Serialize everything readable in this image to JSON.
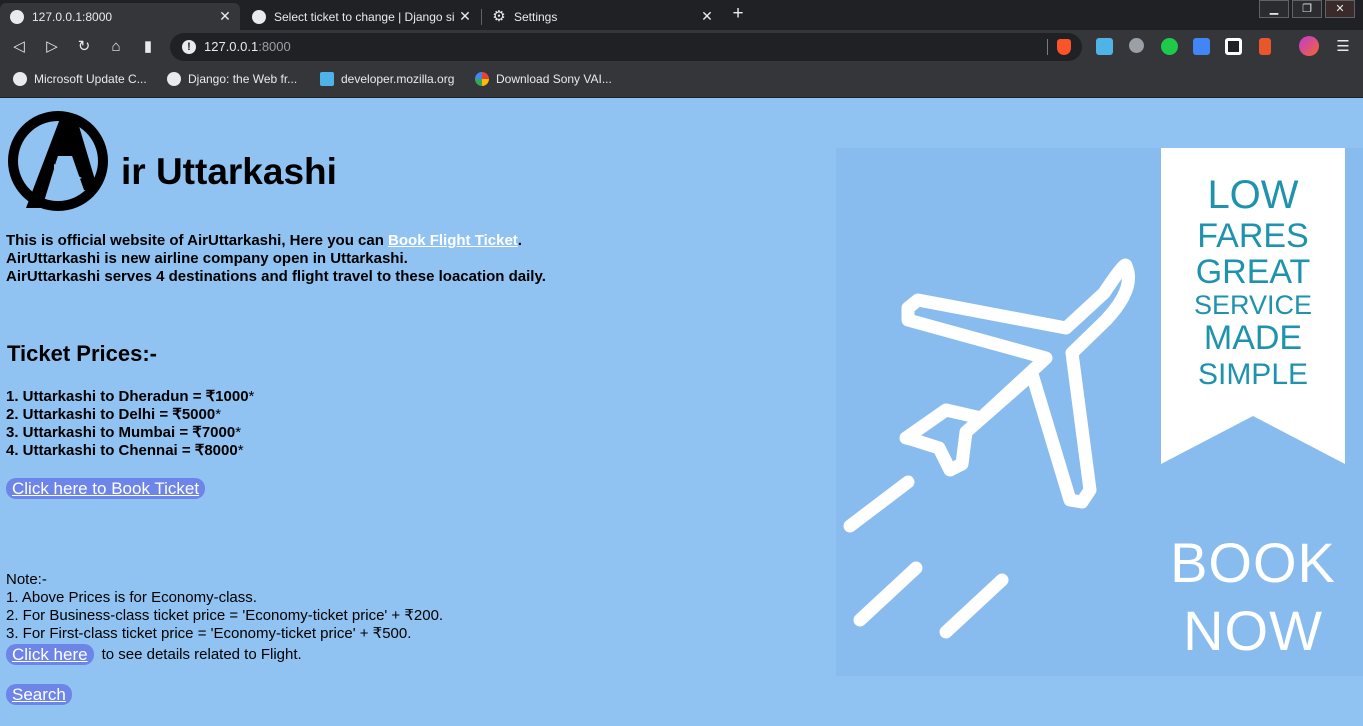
{
  "browser": {
    "tabs": [
      {
        "title": "127.0.0.1:8000",
        "active": true
      },
      {
        "title": "Select ticket to change | Django si",
        "active": false
      },
      {
        "title": "Settings",
        "active": false
      }
    ],
    "url_host": "127.0.0.1",
    "url_port": ":8000",
    "bookmarks": [
      {
        "label": "Microsoft Update C..."
      },
      {
        "label": "Django: the Web fr..."
      },
      {
        "label": "developer.mozilla.org"
      },
      {
        "label": "Download Sony VAI..."
      }
    ]
  },
  "site": {
    "logo_text": "ir Uttarkashi",
    "intro_line1_prefix": "This is official website of AirUttarkashi, Here you can ",
    "intro_link": "Book Flight Ticket",
    "intro_line1_suffix": ".",
    "intro_line2": "AirUttarkashi is new airline company open in Uttarkashi.",
    "intro_line3": "AirUttarkashi serves 4 destinations and flight travel to these loacation daily.",
    "prices_heading": "Ticket Prices:-",
    "prices": [
      {
        "route": "1. Uttarkashi to Dheradun = ₹1000",
        "mark": "*"
      },
      {
        "route": "2. Uttarkashi to Delhi = ₹5000",
        "mark": "*"
      },
      {
        "route": "3. Uttarkashi to Mumbai = ₹7000",
        "mark": "*"
      },
      {
        "route": "4. Uttarkashi to Chennai = ₹8000",
        "mark": "*"
      }
    ],
    "book_button": "Click here to Book Ticket",
    "note_title": "Note:-",
    "notes": [
      "1. Above Prices is for Economy-class.",
      "2. For Business-class ticket price = 'Economy-ticket price' + ₹200.",
      "3. For First-class ticket price = 'Economy-ticket price' + ₹500."
    ],
    "details_link": "Click here",
    "details_text": "to see details related to Flight.",
    "search_button": "Search",
    "ad": {
      "ribbon_lines": [
        "LOW",
        "FARES",
        "GREAT",
        "SERVICE",
        "MADE",
        "SIMPLE"
      ],
      "cta_lines": [
        "BOOK",
        "NOW"
      ]
    }
  },
  "colors": {
    "page_bg": "#90c3f2",
    "button_bg": "#6d84e8",
    "ribbon_text": "#1f93ad"
  }
}
